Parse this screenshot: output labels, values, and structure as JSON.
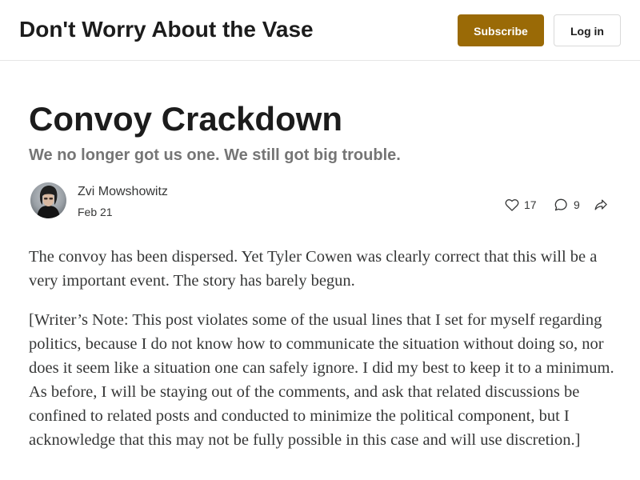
{
  "header": {
    "site_title": "Don't Worry About the Vase",
    "subscribe_label": "Subscribe",
    "login_label": "Log in",
    "accent_color": "#9a6a06"
  },
  "post": {
    "title": "Convoy Crackdown",
    "subtitle": "We no longer got us one. We still got big trouble.",
    "author": "Zvi Mowshowitz",
    "date": "Feb 21",
    "likes": "17",
    "comments": "9",
    "icons": [
      "heart-icon",
      "comment-icon",
      "share-icon"
    ]
  },
  "body": {
    "paragraphs": [
      "The convoy has been dispersed. Yet Tyler Cowen was clearly correct that this will be a very important event. The story has barely begun.",
      "[Writer’s Note: This post violates some of the usual lines that I set for myself regarding politics, because I do not know how to communicate the situation without doing so, nor does it seem like a situation one can safely ignore. I did my best to keep it to a minimum. As before, I will be staying out of the comments, and ask that related discussions be confined to related posts and conducted to minimize the political component, but I acknowledge that this may not be fully possible in this case and will use discretion.]"
    ]
  }
}
